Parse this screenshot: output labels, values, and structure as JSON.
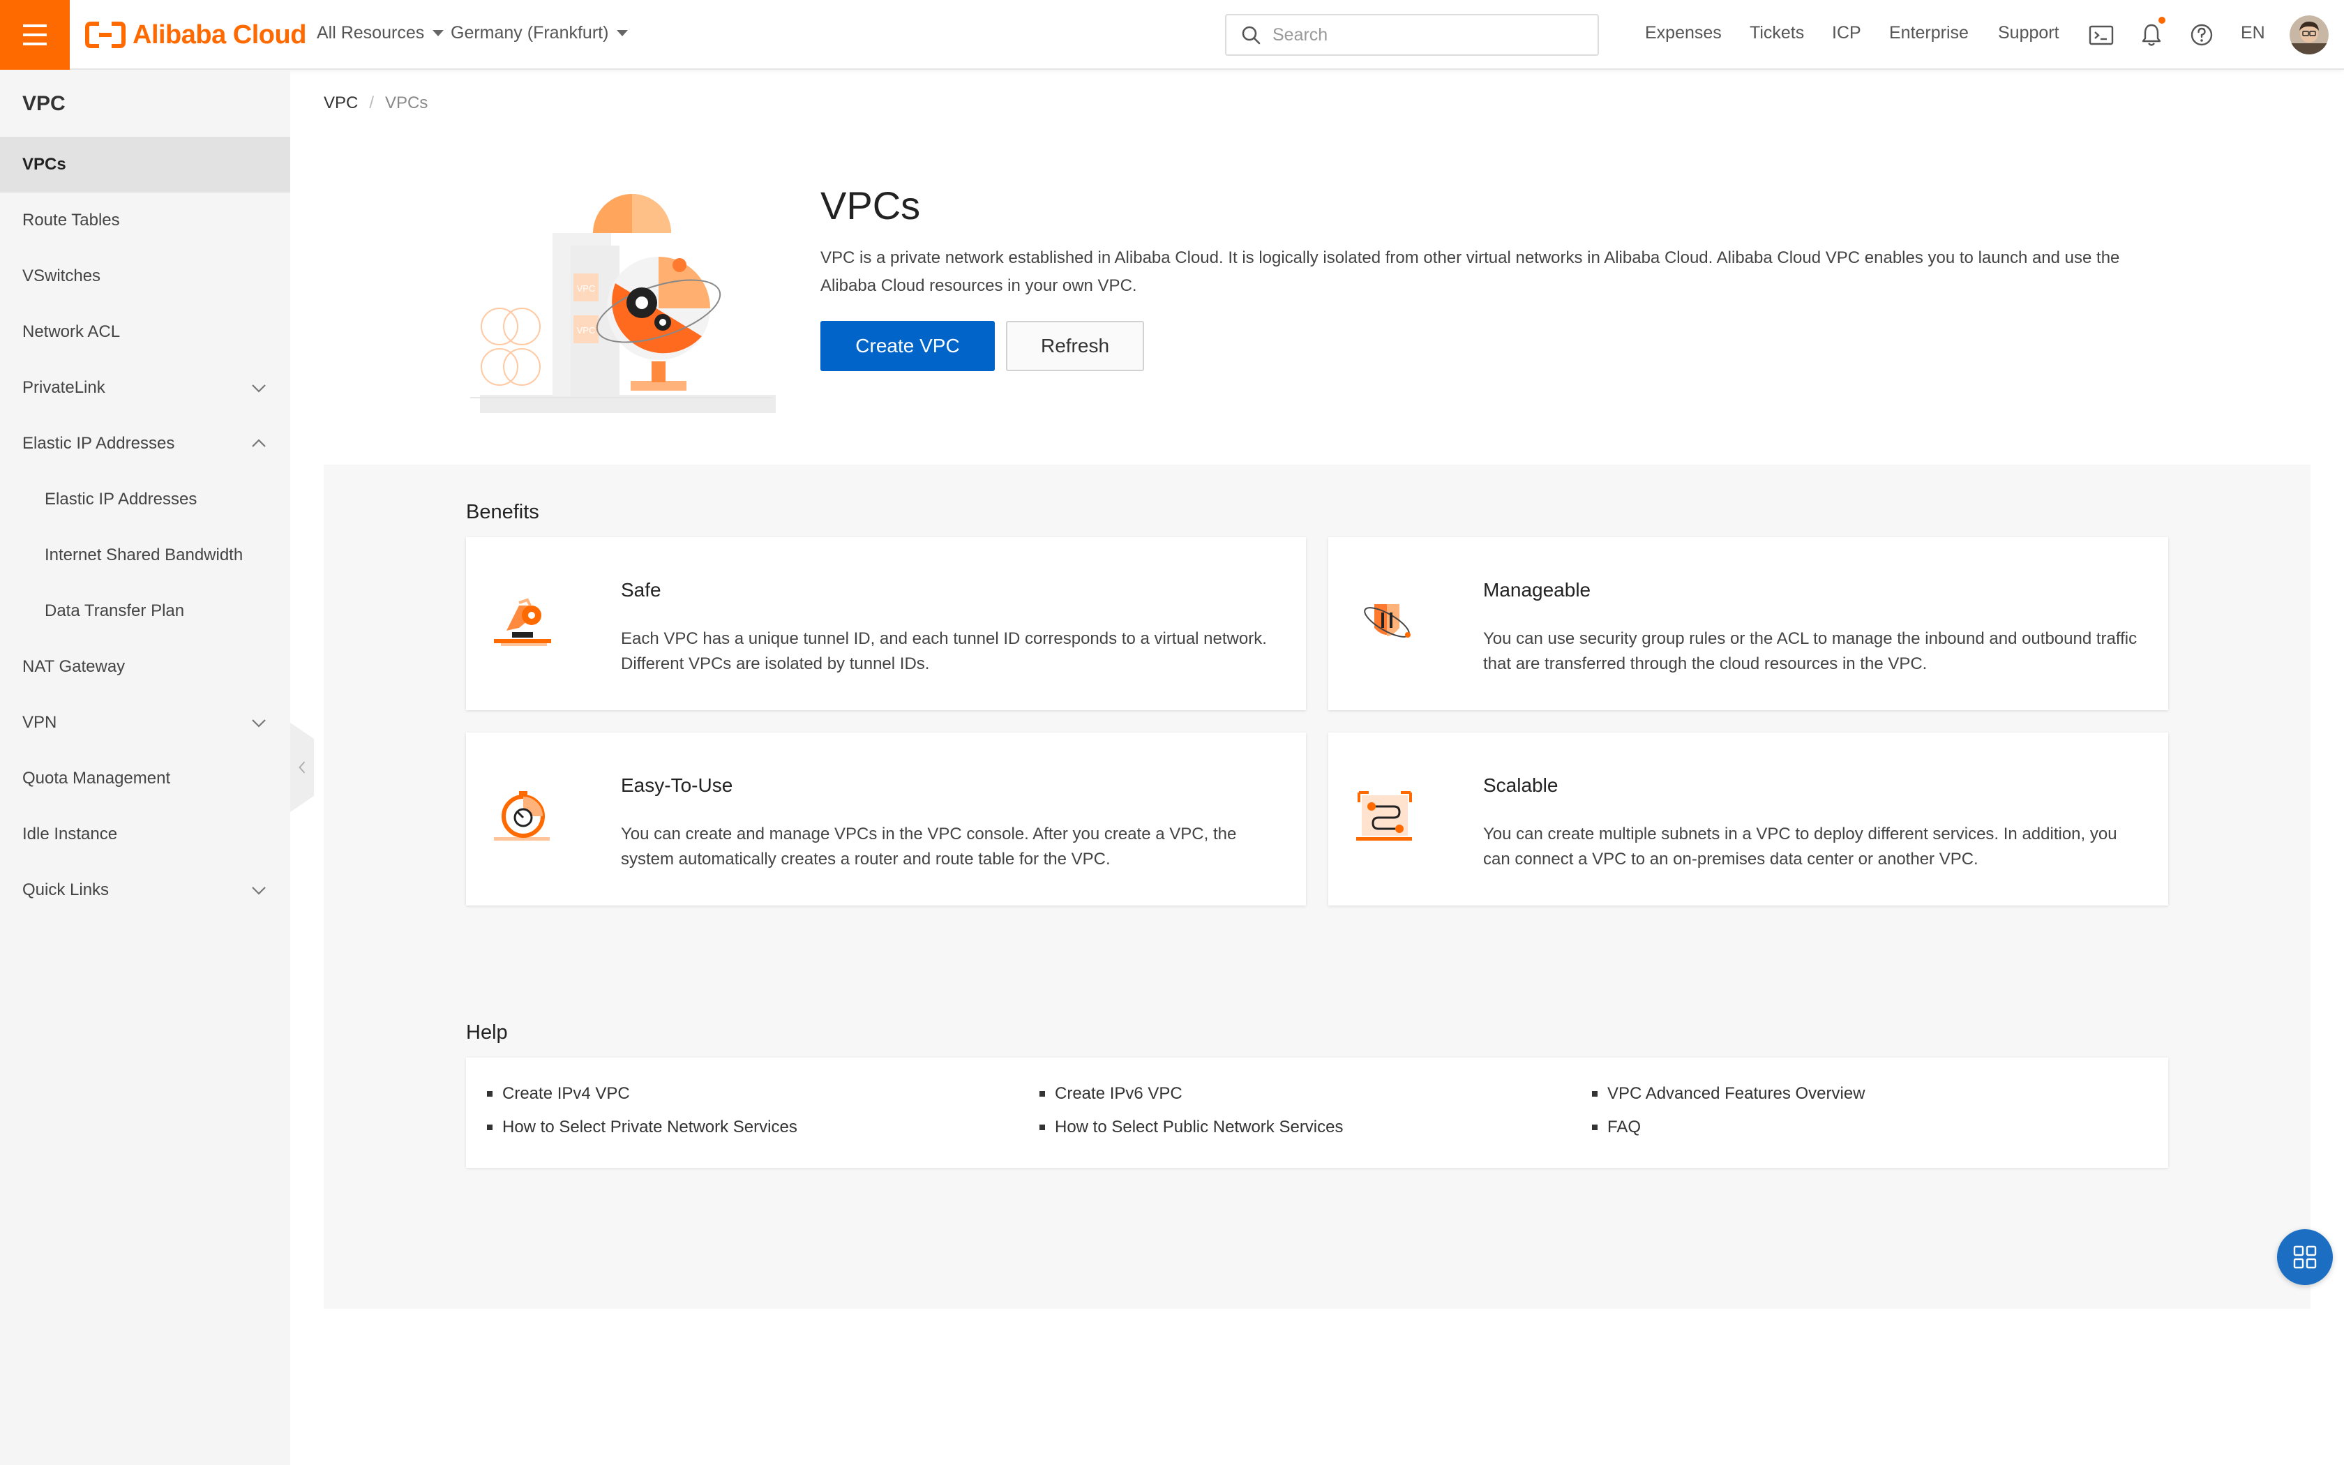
{
  "topbar": {
    "brand": "Alibaba Cloud",
    "resource_dropdown": "All Resources",
    "region_dropdown": "Germany (Frankfurt)",
    "search_placeholder": "Search",
    "links": [
      "Expenses",
      "Tickets",
      "ICP",
      "Enterprise",
      "Support"
    ],
    "language": "EN",
    "icons": [
      "terminal-icon",
      "bell-icon",
      "help-icon"
    ],
    "accent_color": "#ff6a00"
  },
  "sidebar": {
    "title": "VPC",
    "items": [
      {
        "label": "VPCs",
        "active": true
      },
      {
        "label": "Route Tables"
      },
      {
        "label": "VSwitches"
      },
      {
        "label": "Network ACL"
      },
      {
        "label": "PrivateLink",
        "chevron": "down"
      },
      {
        "label": "Elastic IP Addresses",
        "chevron": "up"
      },
      {
        "label": "Elastic IP Addresses",
        "sub": true
      },
      {
        "label": "Internet Shared Bandwidth",
        "sub": true
      },
      {
        "label": "Data Transfer Plan",
        "sub": true
      },
      {
        "label": "NAT Gateway"
      },
      {
        "label": "VPN",
        "chevron": "down"
      },
      {
        "label": "Quota Management"
      },
      {
        "label": "Idle Instance"
      },
      {
        "label": "Quick Links",
        "chevron": "down"
      }
    ]
  },
  "breadcrumb": [
    "VPC",
    "VPCs"
  ],
  "hero": {
    "title": "VPCs",
    "description": "VPC is a private network established in Alibaba Cloud. It is logically isolated from other virtual networks in Alibaba Cloud. Alibaba Cloud VPC enables you to launch and use the Alibaba Cloud resources in your own VPC.",
    "illustration_label": "VPC",
    "primary_button": "Create VPC",
    "secondary_button": "Refresh",
    "primary_color": "#0064c8"
  },
  "benefits": {
    "title": "Benefits",
    "cards": [
      {
        "title": "Safe",
        "description": "Each VPC has a unique tunnel ID, and each tunnel ID corresponds to a virtual network. Different VPCs are isolated by tunnel IDs.",
        "icon": "shield-icon"
      },
      {
        "title": "Manageable",
        "description": "You can use security group rules or the ACL to manage the inbound and outbound traffic that are transferred through the cloud resources in the VPC.",
        "icon": "security-rules-icon"
      },
      {
        "title": "Easy-To-Use",
        "description": "You can create and manage VPCs in the VPC console. After you create a VPC, the system automatically creates a router and route table for the VPC.",
        "icon": "stopwatch-icon"
      },
      {
        "title": "Scalable",
        "description": "You can create multiple subnets in a VPC to deploy different services. In addition, you can connect a VPC to an on-premises data center or another VPC.",
        "icon": "subnet-icon"
      }
    ]
  },
  "help": {
    "title": "Help",
    "links": [
      "Create IPv4 VPC",
      "Create IPv6 VPC",
      "VPC Advanced Features Overview",
      "How to Select Private Network Services",
      "How to Select Public Network Services",
      "FAQ"
    ]
  },
  "floating_button_icon": "apps-grid-icon"
}
